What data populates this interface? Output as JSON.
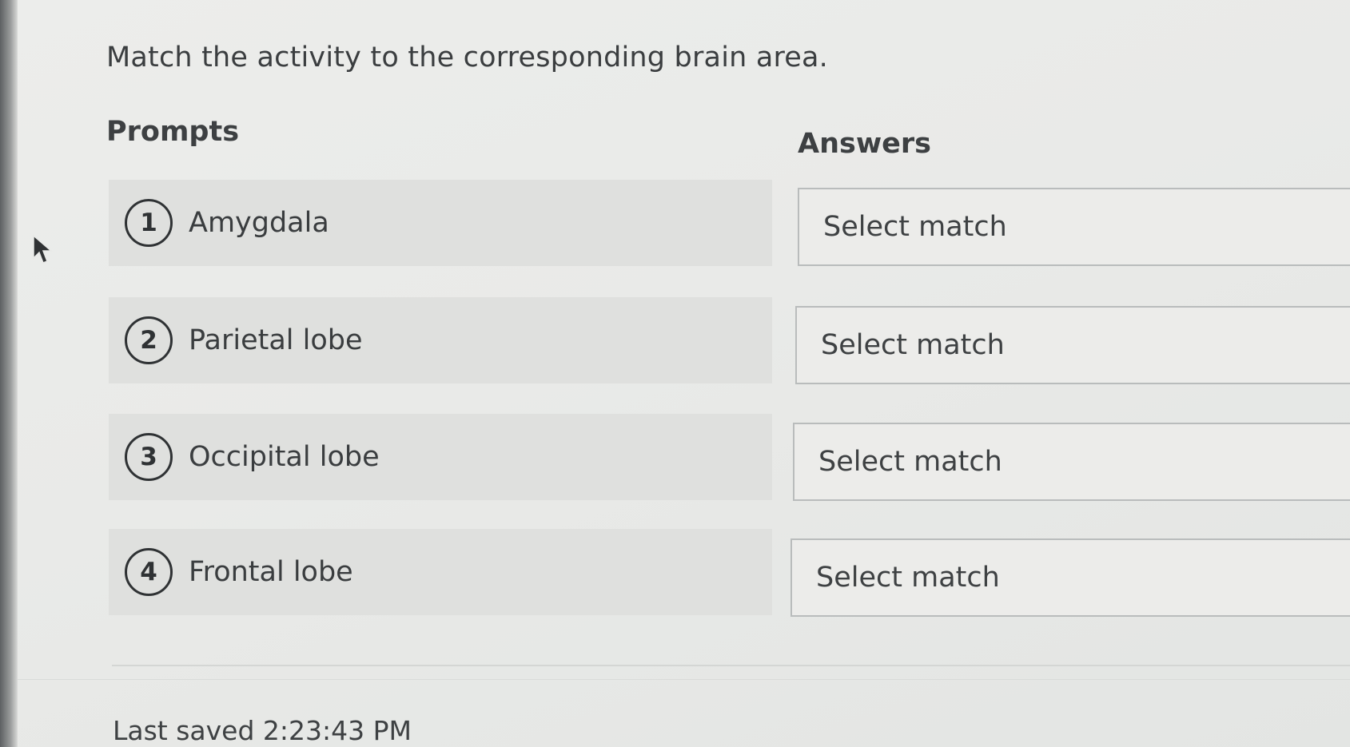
{
  "question": {
    "text": "Match the activity to the corresponding brain area."
  },
  "prompts": {
    "heading": "Prompts",
    "items": [
      {
        "number": "1",
        "label": "Amygdala"
      },
      {
        "number": "2",
        "label": "Parietal lobe"
      },
      {
        "number": "3",
        "label": "Occipital lobe"
      },
      {
        "number": "4",
        "label": "Frontal lobe"
      }
    ]
  },
  "answers": {
    "heading": "Answers",
    "items": [
      {
        "value": "Select match"
      },
      {
        "value": "Select match"
      },
      {
        "value": "Select match"
      },
      {
        "value": "Select match"
      }
    ]
  },
  "footer": {
    "last_saved": "Last saved 2:23:43 PM"
  },
  "icons": {
    "cursor": "mouse-pointer-icon"
  },
  "colors": {
    "background": "#e8e9e7",
    "prompt_row": "#dfe0de",
    "text": "#3a3d3f",
    "select_border": "#b9bcbc"
  }
}
